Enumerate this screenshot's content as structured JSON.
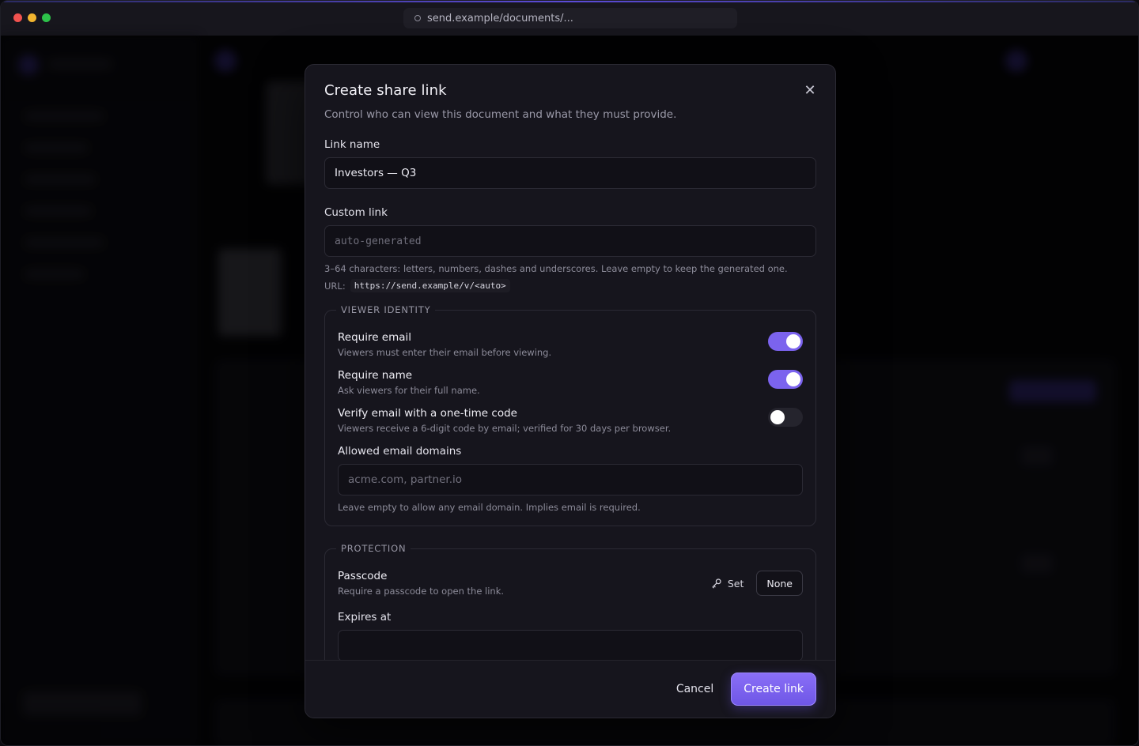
{
  "browser": {
    "url": "send.example/documents/..."
  },
  "modal": {
    "title": "Create share link",
    "subtitle": "Control who can view this document and what they must provide.",
    "close_icon": "close-icon",
    "link_name": {
      "label": "Link name",
      "value": "Investors — Q3"
    },
    "custom_link": {
      "label": "Custom link",
      "placeholder": "auto-generated",
      "hint": "3–64 characters: letters, numbers, dashes and underscores. Leave empty to keep the generated one.",
      "url_label": "URL:",
      "url_value": "https://send.example/v/<auto>"
    },
    "viewer_identity": {
      "legend": "VIEWER IDENTITY",
      "require_email": {
        "title": "Require email",
        "desc": "Viewers must enter their email before viewing.",
        "on": true
      },
      "require_name": {
        "title": "Require name",
        "desc": "Ask viewers for their full name.",
        "on": true
      },
      "verify_email": {
        "title": "Verify email with a one-time code",
        "desc": "Viewers receive a 6-digit code by email; verified for 30 days per browser.",
        "on": false
      },
      "allowed_domains": {
        "label": "Allowed email domains",
        "placeholder": "acme.com, partner.io",
        "hint": "Leave empty to allow any email domain. Implies email is required."
      }
    },
    "protection": {
      "legend": "PROTECTION",
      "passcode": {
        "title": "Passcode",
        "desc": "Require a passcode to open the link.",
        "set_label": "Set",
        "set_icon": "key-icon",
        "none_label": "None"
      },
      "expires": {
        "label": "Expires at"
      }
    },
    "footer": {
      "cancel_label": "Cancel",
      "create_label": "Create link"
    }
  },
  "colors": {
    "accent": "#7b63ee",
    "modal_bg": "#16151d",
    "toggle_off": "#25242d"
  }
}
